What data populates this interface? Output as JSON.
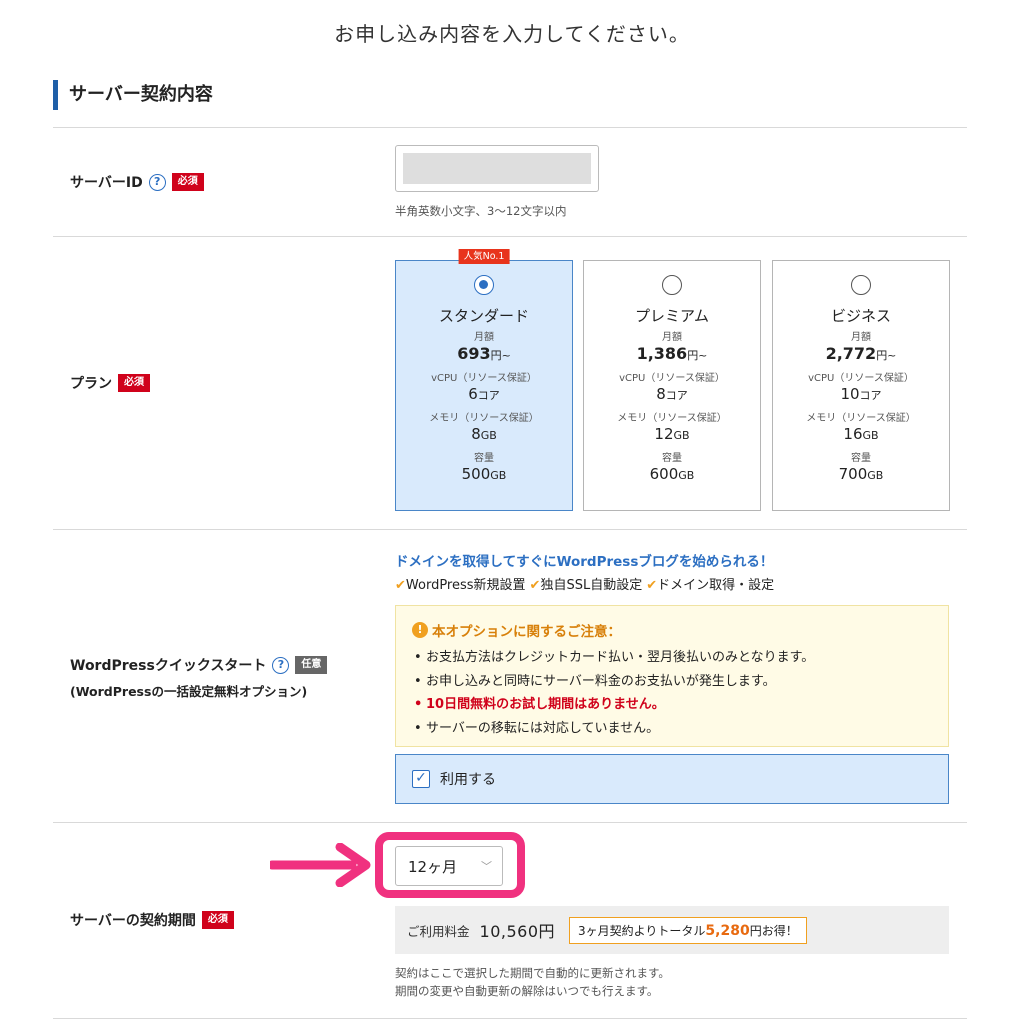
{
  "page": {
    "heading": "お申し込み内容を入力してください。",
    "section_title": "サーバー契約内容"
  },
  "server_id": {
    "label": "サーバーID",
    "required_badge": "必須",
    "hint": "半角英数小文字、3～12文字以内"
  },
  "plan": {
    "label": "プラン",
    "required_badge": "必須",
    "popular_tag": "人気No.1",
    "month_label": "月額",
    "price_suffix": "円~",
    "vcpu_label": "vCPU（リソース保証）",
    "vcpu_unit": "コア",
    "memory_label": "メモリ（リソース保証）",
    "gb_unit": "GB",
    "storage_label": "容量",
    "cards": [
      {
        "name": "スタンダード",
        "price": "693",
        "vcpu": "6",
        "memory": "8",
        "storage": "500",
        "selected": true
      },
      {
        "name": "プレミアム",
        "price": "1,386",
        "vcpu": "8",
        "memory": "12",
        "storage": "600",
        "selected": false
      },
      {
        "name": "ビジネス",
        "price": "2,772",
        "vcpu": "10",
        "memory": "16",
        "storage": "700",
        "selected": false
      }
    ]
  },
  "wordpress": {
    "label": "WordPressクイックスタート",
    "optional_badge": "任意",
    "sublabel": "(WordPressの一括設定無料オプション)",
    "promo": "ドメインを取得してすぐにWordPressブログを始められる！",
    "features": [
      "WordPress新規設置",
      "独自SSL自動設定",
      "ドメイン取得・設定"
    ],
    "notice_title": "本オプションに関するご注意：",
    "notice_items": [
      "お支払方法はクレジットカード払い・翌月後払いのみとなります。",
      "お申し込みと同時にサーバー料金のお支払いが発生します。",
      "10日間無料のお試し期間はありません。",
      "サーバーの移転には対応していません。"
    ],
    "use_label": "利用する",
    "use_checked": true
  },
  "contract": {
    "label": "サーバーの契約期間",
    "required_badge": "必須",
    "selected_period": "12ヶ月",
    "fee_label": "ご利用料金",
    "fee_value": "10,560円",
    "savings_prefix": "3ヶ月契約よりトータル",
    "savings_amount": "5,280",
    "savings_suffix": "円お得！",
    "note_line1": "契約はここで選択した期間で自動的に更新されます。",
    "note_line2": "期間の変更や自動更新の解除はいつでも行えます。"
  },
  "colors": {
    "accent_blue": "#2c6fc2",
    "required_red": "#d0021b",
    "highlight_pink": "#f0317f",
    "savings_orange": "#e86a10"
  }
}
